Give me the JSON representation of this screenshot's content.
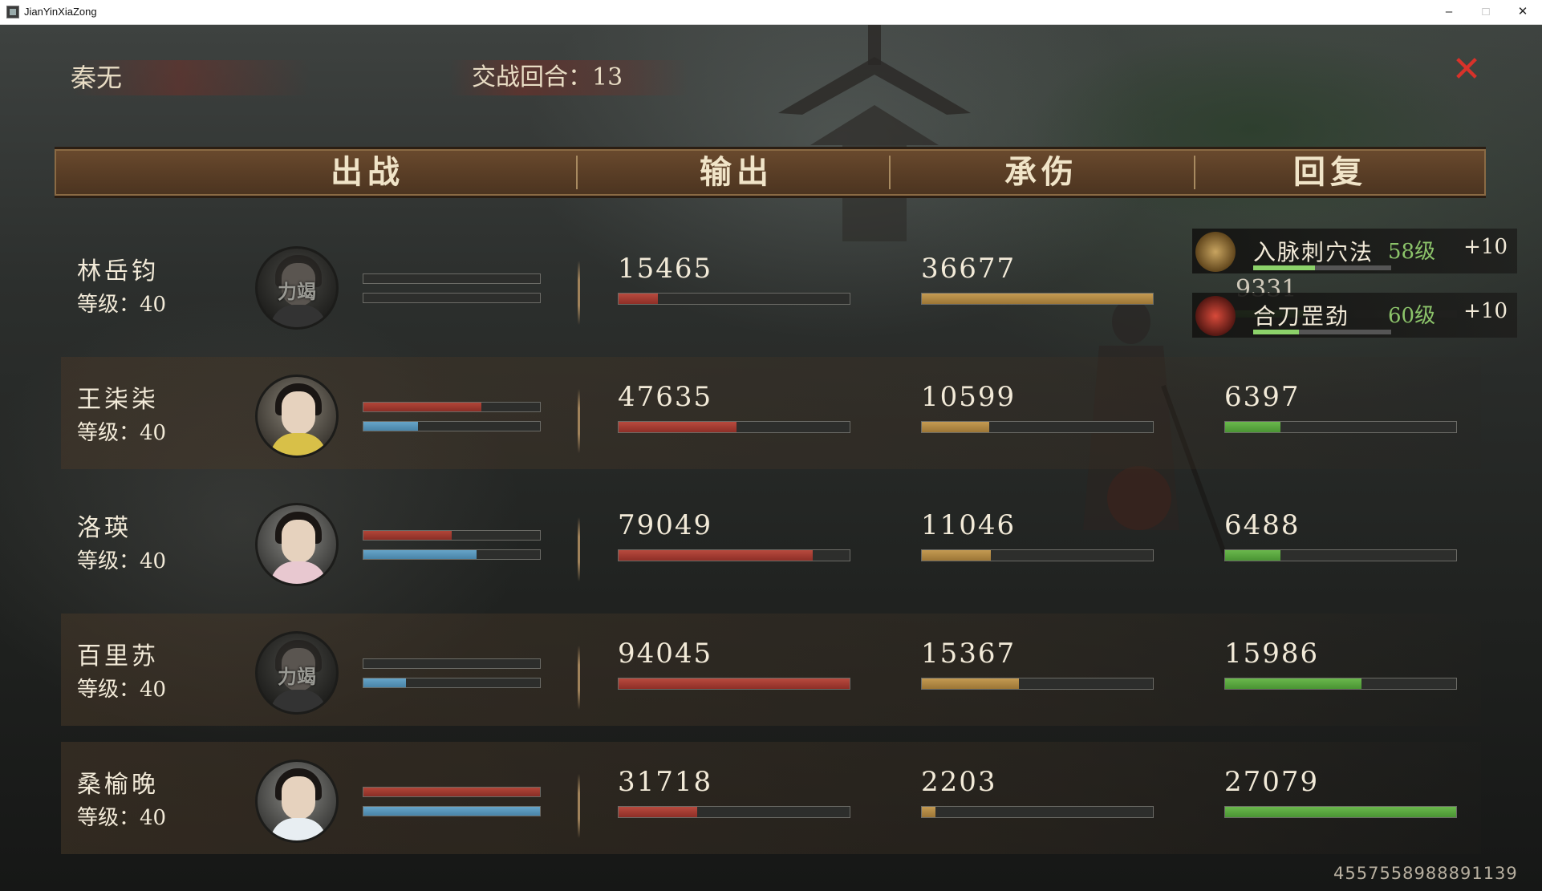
{
  "window": {
    "title": "JianYinXiaZong",
    "minimize": "–",
    "maximize": "□",
    "close": "✕"
  },
  "top": {
    "player_name": "秦无",
    "round_label": "交战回合：13",
    "close_glyph": "✕"
  },
  "header": {
    "col_fight": "出战",
    "col_output": "输出",
    "col_damage_taken": "承伤",
    "col_heal": "回复"
  },
  "characters": [
    {
      "name": "林岳钧",
      "level": "等级：40",
      "status": "力竭",
      "hp": 0,
      "mp": 0,
      "output": "15465",
      "output_fill": 0.17,
      "taken": "36677",
      "taken_fill": 1.0,
      "heal": "9331",
      "heal_fill": 0.35
    },
    {
      "name": "王柒柒",
      "level": "等级：40",
      "status": "",
      "hp": 0.67,
      "mp": 0.31,
      "output": "47635",
      "output_fill": 0.51,
      "taken": "10599",
      "taken_fill": 0.29,
      "heal": "6397",
      "heal_fill": 0.24
    },
    {
      "name": "洛瑛",
      "level": "等级：40",
      "status": "",
      "hp": 0.5,
      "mp": 0.64,
      "output": "79049",
      "output_fill": 0.84,
      "taken": "11046",
      "taken_fill": 0.3,
      "heal": "6488",
      "heal_fill": 0.24
    },
    {
      "name": "百里苏",
      "level": "等级：40",
      "status": "力竭",
      "hp": 0,
      "mp": 0.24,
      "output": "94045",
      "output_fill": 1.0,
      "taken": "15367",
      "taken_fill": 0.42,
      "heal": "15986",
      "heal_fill": 0.59
    },
    {
      "name": "桑榆晚",
      "level": "等级：40",
      "status": "",
      "hp": 1.0,
      "mp": 1.0,
      "output": "31718",
      "output_fill": 0.34,
      "taken": "2203",
      "taken_fill": 0.06,
      "heal": "27079",
      "heal_fill": 1.0
    }
  ],
  "buffs": [
    {
      "name": "入脉刺穴法",
      "level": "58级",
      "bonus": "+10",
      "progress": 0.45,
      "icon": "helmet-skill-icon"
    },
    {
      "name": "合刀罡劲",
      "level": "60级",
      "bonus": "+10",
      "progress": 0.33,
      "icon": "red-slash-skill-icon"
    }
  ],
  "uid": "4557558988891139",
  "colors": {
    "output": "#b84a3e",
    "damage_taken": "#c49a52",
    "heal": "#6ab84c",
    "hp": "#b24538",
    "mp": "#66a4c8",
    "close": "#d8322a"
  }
}
